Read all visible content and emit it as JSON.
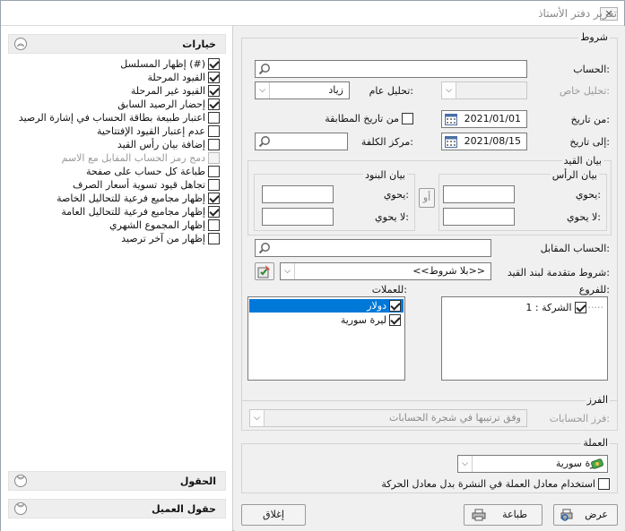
{
  "window": {
    "title": "تقرير دفتر الأستاذ",
    "close": "✕"
  },
  "options": {
    "header": "خيارات",
    "items": [
      {
        "label": "إظهار المسلسل (#)",
        "checked": true,
        "disabled": false
      },
      {
        "label": "القيود المرحلة",
        "checked": true,
        "disabled": false
      },
      {
        "label": "القيود غير المرحلة",
        "checked": true,
        "disabled": false
      },
      {
        "label": "إحضار الرصيد السابق",
        "checked": true,
        "disabled": false
      },
      {
        "label": "اعتبار طبيعة بطاقة الحساب في إشارة الرصيد",
        "checked": false,
        "disabled": false
      },
      {
        "label": "عدم إعتبار القيود الإفتتاحية",
        "checked": false,
        "disabled": false
      },
      {
        "label": "إضافة بيان رأس القيد",
        "checked": false,
        "disabled": false
      },
      {
        "label": "دمج رمز الحساب المقابل مع الاسم",
        "checked": false,
        "disabled": true
      },
      {
        "label": "طباعة كل حساب على صفحة",
        "checked": false,
        "disabled": false
      },
      {
        "label": "تجاهل قيود تسوية أسعار الصرف",
        "checked": false,
        "disabled": false
      },
      {
        "label": "إظهار مجاميع فرعية للتحاليل الخاصة",
        "checked": true,
        "disabled": false
      },
      {
        "label": "إظهار مجاميع فرعية للتحاليل العامة",
        "checked": true,
        "disabled": false
      },
      {
        "label": "إظهار المجموع الشهري",
        "checked": false,
        "disabled": false
      },
      {
        "label": "إظهار من آخر ترصيد",
        "checked": false,
        "disabled": false
      }
    ]
  },
  "fields_section": {
    "header": "الحقول"
  },
  "customer_fields_section": {
    "header": "حقول العميل"
  },
  "conditions": {
    "title": "شروط",
    "account_label": "الحساب:",
    "account_value": "",
    "special_analysis_label": "تحليل خاص:",
    "general_analysis_label": "تحليل عام:",
    "general_analysis_value": "زياد",
    "from_date_label": "من تاريخ:",
    "from_date_value": "2021/01/01",
    "from_match_label": "من تاريخ المطابقة",
    "to_date_label": "إلى تاريخ:",
    "to_date_value": "2021/08/15",
    "cost_center_label": "مركز الكلفة:",
    "cost_center_value": "",
    "entry_statement": {
      "title": "بيان القيد",
      "head_statement_title": "بيان الرأس",
      "items_statement_title": "بيان البنود",
      "contains_label": "يحوي:",
      "not_contains_label": "لا يحوي:",
      "or_label": "أو"
    },
    "counter_account_label": "الحساب المقابل:",
    "advanced_conditions_label": "شروط متقدمة لبند القيد:",
    "advanced_conditions_value": "<<بلا شروط>>",
    "branches_label": "للفروع:",
    "branches": [
      {
        "label": "1 : الشركة",
        "checked": true
      }
    ],
    "currencies_label": "للعملات:",
    "currencies": [
      {
        "label": "دولار",
        "checked": true,
        "selected": true
      },
      {
        "label": "ليرة سورية",
        "checked": true,
        "selected": false
      }
    ]
  },
  "sorting": {
    "title": "الفرز",
    "accounts_sort_label": "فرز الحسابات:",
    "accounts_sort_value": "وفق ترتيبها في شجرة الحسابات"
  },
  "currency": {
    "title": "العملة",
    "value": "ليرة سورية",
    "use_rate_label": "استخدام معادل العملة في النشرة بدل معادل الحركة"
  },
  "buttons": {
    "show": "عرض",
    "print": "طباعة",
    "close": "إغلاق"
  }
}
